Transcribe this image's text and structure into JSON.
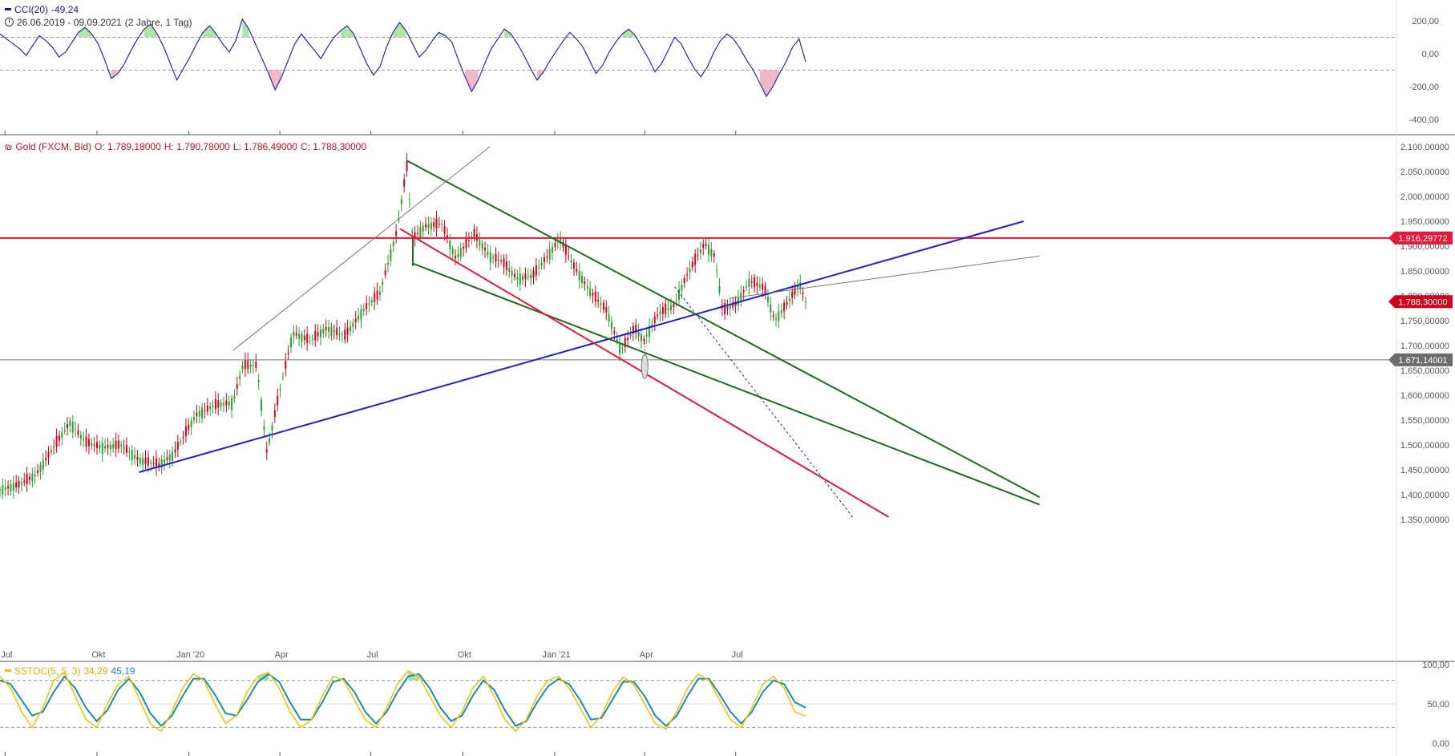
{
  "cci_panel": {
    "indicator": "CCI(20)",
    "value": "-49,24",
    "range": "26.06.2019 - 09.09.2021",
    "period": "(2 Jahre, 1 Tag)",
    "line_color": "#2a2aa0",
    "axis_labels": [
      "200,00",
      "0,00",
      "-200,00",
      "-400,00"
    ],
    "axis_values": [
      200,
      0,
      -200,
      -400
    ],
    "thresholds": [
      100,
      -100
    ]
  },
  "price_panel": {
    "icon": "candlestick-icon",
    "instrument": "Gold (FXCM, Bid)",
    "open": "O: 1.789,18000",
    "high": "H: 1.790,78000",
    "low": "L: 1.786,49000",
    "close": "C: 1.788,30000",
    "header_color": "#cc1122",
    "axis_labels": [
      "2.100,00000",
      "2.050,00000",
      "2.000,00000",
      "1.950,00000",
      "1.900,00000",
      "1.850,00000",
      "1.800,00000",
      "1.750,00000",
      "1.700,00000",
      "1.650,00000",
      "1.600,00000",
      "1.550,00000",
      "1.500,00000",
      "1.450,00000",
      "1.400,00000",
      "1.350,00000"
    ],
    "axis_values": [
      2100,
      2050,
      2000,
      1950,
      1900,
      1850,
      1800,
      1750,
      1700,
      1650,
      1600,
      1550,
      1500,
      1450,
      1400,
      1350
    ],
    "tags": [
      {
        "label": "1.916,29772",
        "value": 1916.3,
        "color": "#e8173c"
      },
      {
        "label": "1.788,30000",
        "value": 1788.3,
        "color": "#d0021b"
      },
      {
        "label": "1.671,14001",
        "value": 1671.14,
        "color": "#6b6b6b"
      }
    ],
    "x_labels": [
      "Jul",
      "Okt",
      "Jan '20",
      "Apr",
      "Jul",
      "Okt",
      "Jan '21",
      "Apr",
      "Jul"
    ]
  },
  "stoch_panel": {
    "indicator": "SSTOC(5, 5, 3)",
    "k_value": "34,29",
    "d_value": "45,19",
    "k_color": "#f2c200",
    "d_color": "#1a8cb0",
    "axis_labels": [
      "100,00",
      "50,00",
      "0,00"
    ],
    "axis_values": [
      100,
      50,
      0
    ],
    "thresholds": [
      80,
      20
    ]
  },
  "chart_data": [
    {
      "type": "line",
      "title": "CCI(20)",
      "series": [
        {
          "name": "CCI(20)",
          "values": [
            120,
            90,
            60,
            30,
            -10,
            50,
            110,
            80,
            40,
            -20,
            10,
            70,
            130,
            160,
            120,
            60,
            -40,
            -150,
            -120,
            -60,
            20,
            90,
            150,
            180,
            120,
            40,
            -60,
            -160,
            -90,
            -20,
            60,
            130,
            170,
            120,
            60,
            10,
            80,
            210,
            150,
            60,
            -30,
            -120,
            -220,
            -140,
            -40,
            60,
            120,
            70,
            20,
            -30,
            40,
            100,
            140,
            170,
            120,
            30,
            -60,
            -130,
            -80,
            40,
            130,
            190,
            140,
            60,
            -20,
            20,
            80,
            130,
            110,
            70,
            -40,
            -140,
            -230,
            -160,
            -60,
            30,
            90,
            150,
            120,
            60,
            -10,
            -90,
            -160,
            -110,
            -40,
            20,
            80,
            130,
            90,
            40,
            -40,
            -120,
            -70,
            10,
            70,
            120,
            150,
            110,
            40,
            -30,
            -110,
            -60,
            20,
            100,
            60,
            -20,
            -90,
            -140,
            -80,
            10,
            80,
            120,
            90,
            30,
            -40,
            -100,
            -180,
            -260,
            -200,
            -120,
            -50,
            40,
            90,
            -49.24
          ]
        }
      ],
      "ylim": [
        -450,
        250
      ]
    },
    {
      "type": "candlestick",
      "title": "Gold (FXCM, Bid)",
      "x": [
        "2019-06-26",
        "2019-07-15",
        "2019-08-01",
        "2019-08-20",
        "2019-09-04",
        "2019-09-20",
        "2019-10-07",
        "2019-10-25",
        "2019-11-12",
        "2019-12-02",
        "2019-12-16",
        "2020-01-08",
        "2020-01-27",
        "2020-02-14",
        "2020-02-24",
        "2020-03-09",
        "2020-03-19",
        "2020-03-31",
        "2020-04-14",
        "2020-05-01",
        "2020-05-18",
        "2020-06-05",
        "2020-06-25",
        "2020-07-10",
        "2020-07-27",
        "2020-08-06",
        "2020-08-12",
        "2020-08-24",
        "2020-09-10",
        "2020-09-24",
        "2020-10-12",
        "2020-10-28",
        "2020-11-09",
        "2020-11-24",
        "2020-12-10",
        "2020-12-30",
        "2021-01-06",
        "2021-01-20",
        "2021-02-05",
        "2021-02-22",
        "2021-03-08",
        "2021-03-22",
        "2021-03-31",
        "2021-04-15",
        "2021-04-30",
        "2021-05-14",
        "2021-05-31",
        "2021-06-10",
        "2021-06-18",
        "2021-07-02",
        "2021-07-15",
        "2021-07-30",
        "2021-08-09",
        "2021-08-20",
        "2021-09-03",
        "2021-09-09"
      ],
      "close": [
        1410,
        1420,
        1440,
        1500,
        1545,
        1505,
        1495,
        1500,
        1470,
        1460,
        1480,
        1560,
        1580,
        1585,
        1660,
        1660,
        1485,
        1600,
        1725,
        1710,
        1735,
        1720,
        1775,
        1805,
        1930,
        2060,
        1915,
        1940,
        1945,
        1875,
        1925,
        1880,
        1870,
        1835,
        1840,
        1895,
        1915,
        1860,
        1810,
        1770,
        1690,
        1735,
        1710,
        1765,
        1780,
        1845,
        1905,
        1880,
        1770,
        1785,
        1830,
        1815,
        1750,
        1780,
        1825,
        1788.3
      ],
      "ylim": [
        1330,
        2110
      ]
    },
    {
      "type": "line",
      "title": "SSTOC(5, 5, 3)",
      "series": [
        {
          "name": "SSTOC(5, 5, 3)",
          "values": [
            85,
            70,
            40,
            20,
            45,
            80,
            90,
            60,
            30,
            20,
            50,
            75,
            85,
            55,
            25,
            15,
            40,
            70,
            88,
            80,
            50,
            25,
            35,
            65,
            85,
            90,
            70,
            40,
            20,
            30,
            60,
            85,
            80,
            55,
            30,
            20,
            45,
            75,
            92,
            85,
            60,
            35,
            20,
            40,
            70,
            85,
            60,
            30,
            15,
            30,
            60,
            80,
            85,
            70,
            45,
            20,
            35,
            65,
            84,
            75,
            50,
            25,
            18,
            40,
            70,
            88,
            80,
            55,
            30,
            20,
            45,
            75,
            85,
            70,
            40,
            34.29
          ]
        },
        {
          "name": "",
          "values": [
            80,
            75,
            55,
            35,
            40,
            65,
            85,
            70,
            45,
            28,
            42,
            68,
            82,
            65,
            38,
            22,
            35,
            60,
            82,
            82,
            62,
            38,
            35,
            55,
            78,
            88,
            78,
            52,
            30,
            30,
            52,
            78,
            82,
            65,
            40,
            25,
            40,
            65,
            85,
            88,
            70,
            45,
            28,
            35,
            60,
            80,
            68,
            42,
            22,
            28,
            52,
            72,
            82,
            75,
            55,
            30,
            32,
            55,
            78,
            78,
            60,
            35,
            22,
            35,
            60,
            82,
            82,
            62,
            40,
            25,
            40,
            65,
            80,
            75,
            52,
            45.19
          ]
        }
      ],
      "ylim": [
        -5,
        105
      ]
    }
  ]
}
